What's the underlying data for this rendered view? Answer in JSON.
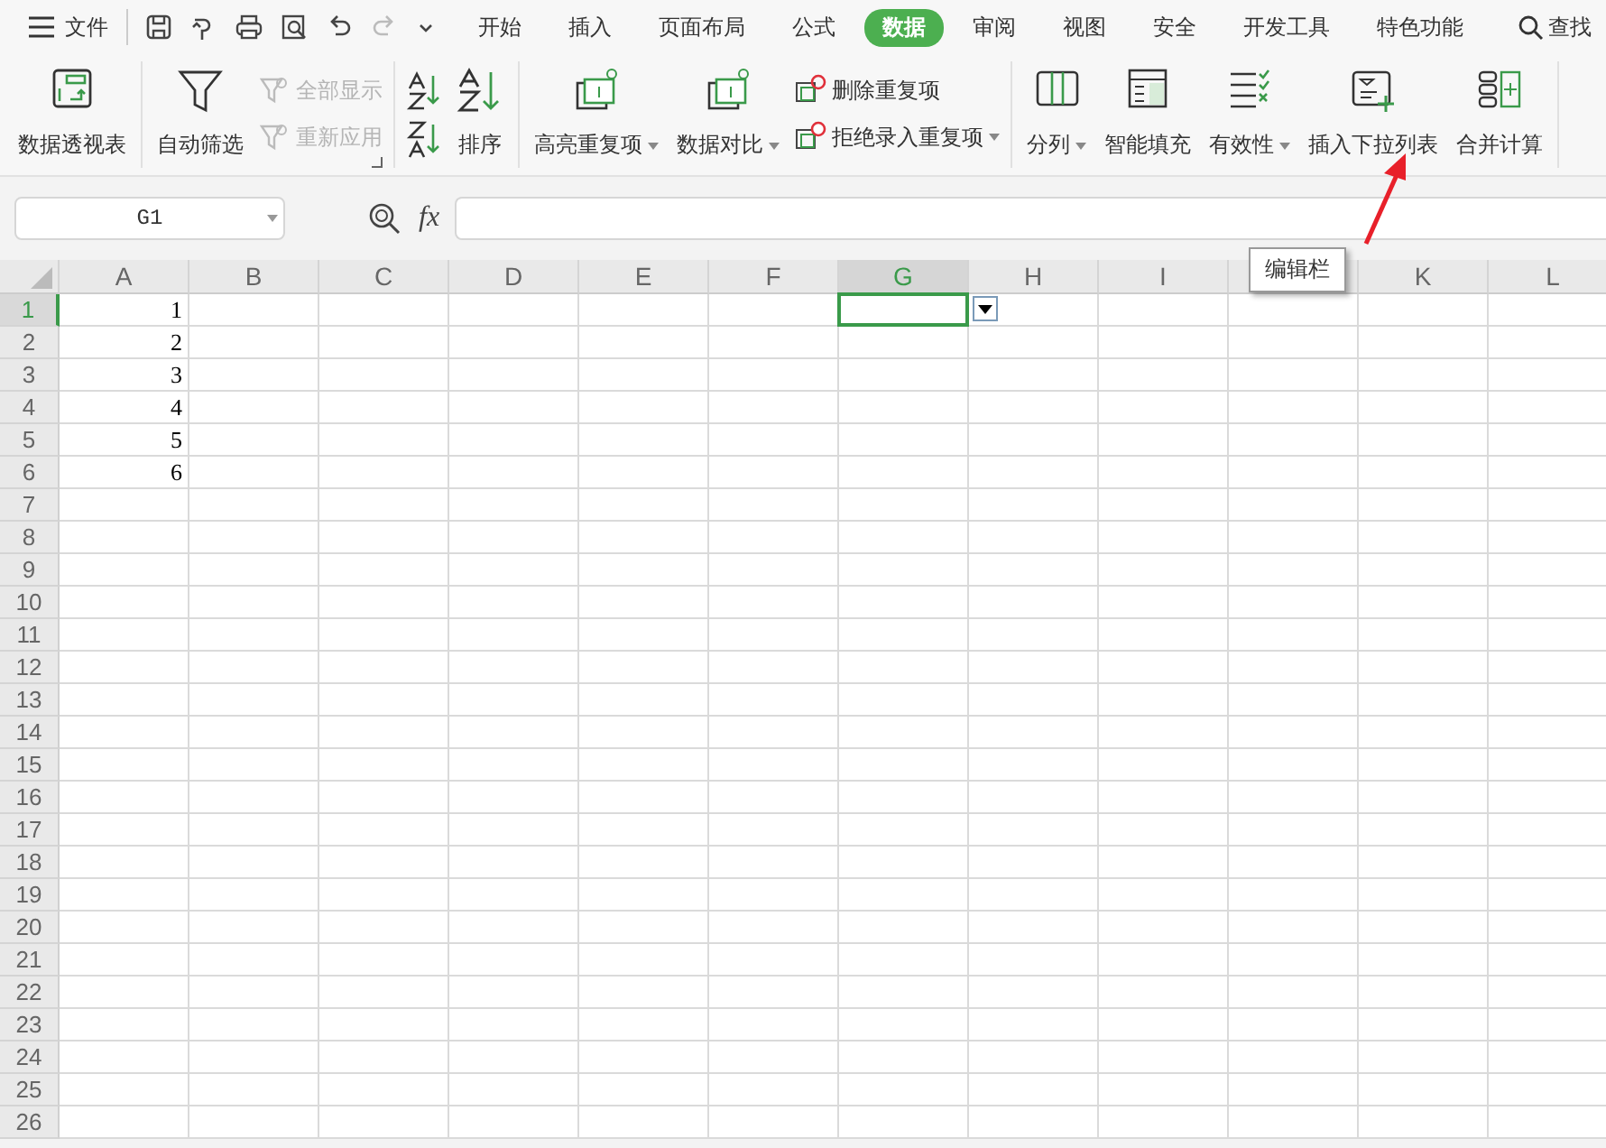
{
  "menu_bar": {
    "file_menu": "文件",
    "tabs": [
      {
        "label": "开始",
        "selected": false
      },
      {
        "label": "插入",
        "selected": false
      },
      {
        "label": "页面布局",
        "selected": false
      },
      {
        "label": "公式",
        "selected": false
      },
      {
        "label": "数据",
        "selected": true
      },
      {
        "label": "审阅",
        "selected": false
      },
      {
        "label": "视图",
        "selected": false
      },
      {
        "label": "安全",
        "selected": false
      },
      {
        "label": "开发工具",
        "selected": false
      },
      {
        "label": "特色功能",
        "selected": false
      }
    ],
    "search": "查找"
  },
  "ribbon": {
    "groups": [
      {
        "items": [
          {
            "kind": "large",
            "label": "数据透视表",
            "dropdown": false,
            "disabled": false
          }
        ]
      },
      {
        "launcher": true,
        "items": [
          {
            "kind": "large",
            "label": "自动筛选",
            "dropdown": false,
            "disabled": false
          },
          {
            "kind": "small",
            "label": "全部显示",
            "dropdown": false,
            "disabled": true
          },
          {
            "kind": "small",
            "label": "重新应用",
            "dropdown": false,
            "disabled": true
          }
        ]
      },
      {
        "items": [
          {
            "kind": "sort",
            "label": "排序",
            "dropdown": false,
            "disabled": false
          }
        ]
      },
      {
        "items": [
          {
            "kind": "large",
            "label": "高亮重复项",
            "dropdown": true,
            "disabled": false
          },
          {
            "kind": "large",
            "label": "数据对比",
            "dropdown": true,
            "disabled": false
          },
          {
            "kind": "small",
            "label": "删除重复项",
            "dropdown": false,
            "disabled": false
          },
          {
            "kind": "small",
            "label": "拒绝录入重复项",
            "dropdown": true,
            "disabled": false
          }
        ]
      },
      {
        "items": [
          {
            "kind": "large",
            "label": "分列",
            "dropdown": true,
            "disabled": false
          },
          {
            "kind": "large",
            "label": "智能填充",
            "dropdown": false,
            "disabled": false
          },
          {
            "kind": "large",
            "label": "有效性",
            "dropdown": true,
            "disabled": false
          },
          {
            "kind": "large",
            "label": "插入下拉列表",
            "dropdown": false,
            "disabled": false
          },
          {
            "kind": "large",
            "label": "合并计算",
            "dropdown": false,
            "disabled": false
          }
        ]
      }
    ]
  },
  "formula_bar": {
    "name_box": "G1",
    "function_label": "fx",
    "tooltip": "编辑栏"
  },
  "sheet": {
    "validation_dropdown": true,
    "columns": [
      {
        "label": "A",
        "selected": false
      },
      {
        "label": "B",
        "selected": false
      },
      {
        "label": "C",
        "selected": false
      },
      {
        "label": "D",
        "selected": false
      },
      {
        "label": "E",
        "selected": false
      },
      {
        "label": "F",
        "selected": false
      },
      {
        "label": "G",
        "selected": true
      },
      {
        "label": "H",
        "selected": false
      },
      {
        "label": "I",
        "selected": false
      },
      {
        "selected": false
      },
      {
        "label": "K",
        "selected": false
      },
      {
        "label": "L",
        "selected": false
      }
    ],
    "rows": [
      {
        "label": "1",
        "selected": true,
        "column_a": "1"
      },
      {
        "label": "2",
        "selected": false,
        "column_a": "2"
      },
      {
        "label": "3",
        "selected": false,
        "column_a": "3"
      },
      {
        "label": "4",
        "selected": false,
        "column_a": "4"
      },
      {
        "label": "5",
        "selected": false,
        "column_a": "5"
      },
      {
        "label": "6",
        "selected": false,
        "column_a": "6"
      },
      {
        "label": "7",
        "selected": false
      },
      {
        "label": "8",
        "selected": false
      },
      {
        "label": "9",
        "selected": false
      },
      {
        "label": "10",
        "selected": false
      },
      {
        "label": "11",
        "selected": false
      },
      {
        "label": "12",
        "selected": false
      },
      {
        "label": "13",
        "selected": false
      },
      {
        "label": "14",
        "selected": false
      },
      {
        "label": "15",
        "selected": false
      },
      {
        "label": "16",
        "selected": false
      },
      {
        "label": "17",
        "selected": false
      },
      {
        "label": "18",
        "selected": false
      },
      {
        "label": "19",
        "selected": false
      },
      {
        "label": "20",
        "selected": false
      },
      {
        "label": "21",
        "selected": false
      },
      {
        "label": "22",
        "selected": false
      },
      {
        "label": "23",
        "selected": false
      },
      {
        "label": "24",
        "selected": false
      },
      {
        "label": "25",
        "selected": false
      },
      {
        "label": "26",
        "selected": false
      }
    ]
  }
}
